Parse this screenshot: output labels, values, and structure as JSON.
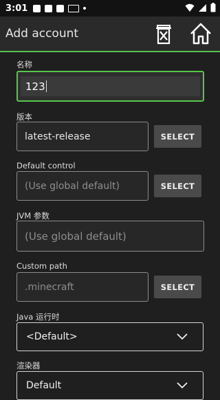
{
  "status_bar": {
    "time": "3:01"
  },
  "app_bar": {
    "title": "Add account"
  },
  "form": {
    "name": {
      "label": "名称",
      "value": "123"
    },
    "version": {
      "label": "版本",
      "value": "latest-release",
      "button": "SELECT"
    },
    "control": {
      "label": "Default control",
      "placeholder": "(Use global default)",
      "button": "SELECT"
    },
    "jvm": {
      "label": "JVM 参数",
      "placeholder": "(Use global default)"
    },
    "path": {
      "label": "Custom path",
      "placeholder": ".minecraft",
      "button": "SELECT"
    },
    "java": {
      "label": "Java 运行时",
      "value": "<Default>"
    },
    "renderer": {
      "label": "渲染器",
      "value": "Default"
    }
  },
  "colors": {
    "accent": "#57c14e",
    "background": "#1f1f1f",
    "app_bar": "#2a2a2a"
  }
}
